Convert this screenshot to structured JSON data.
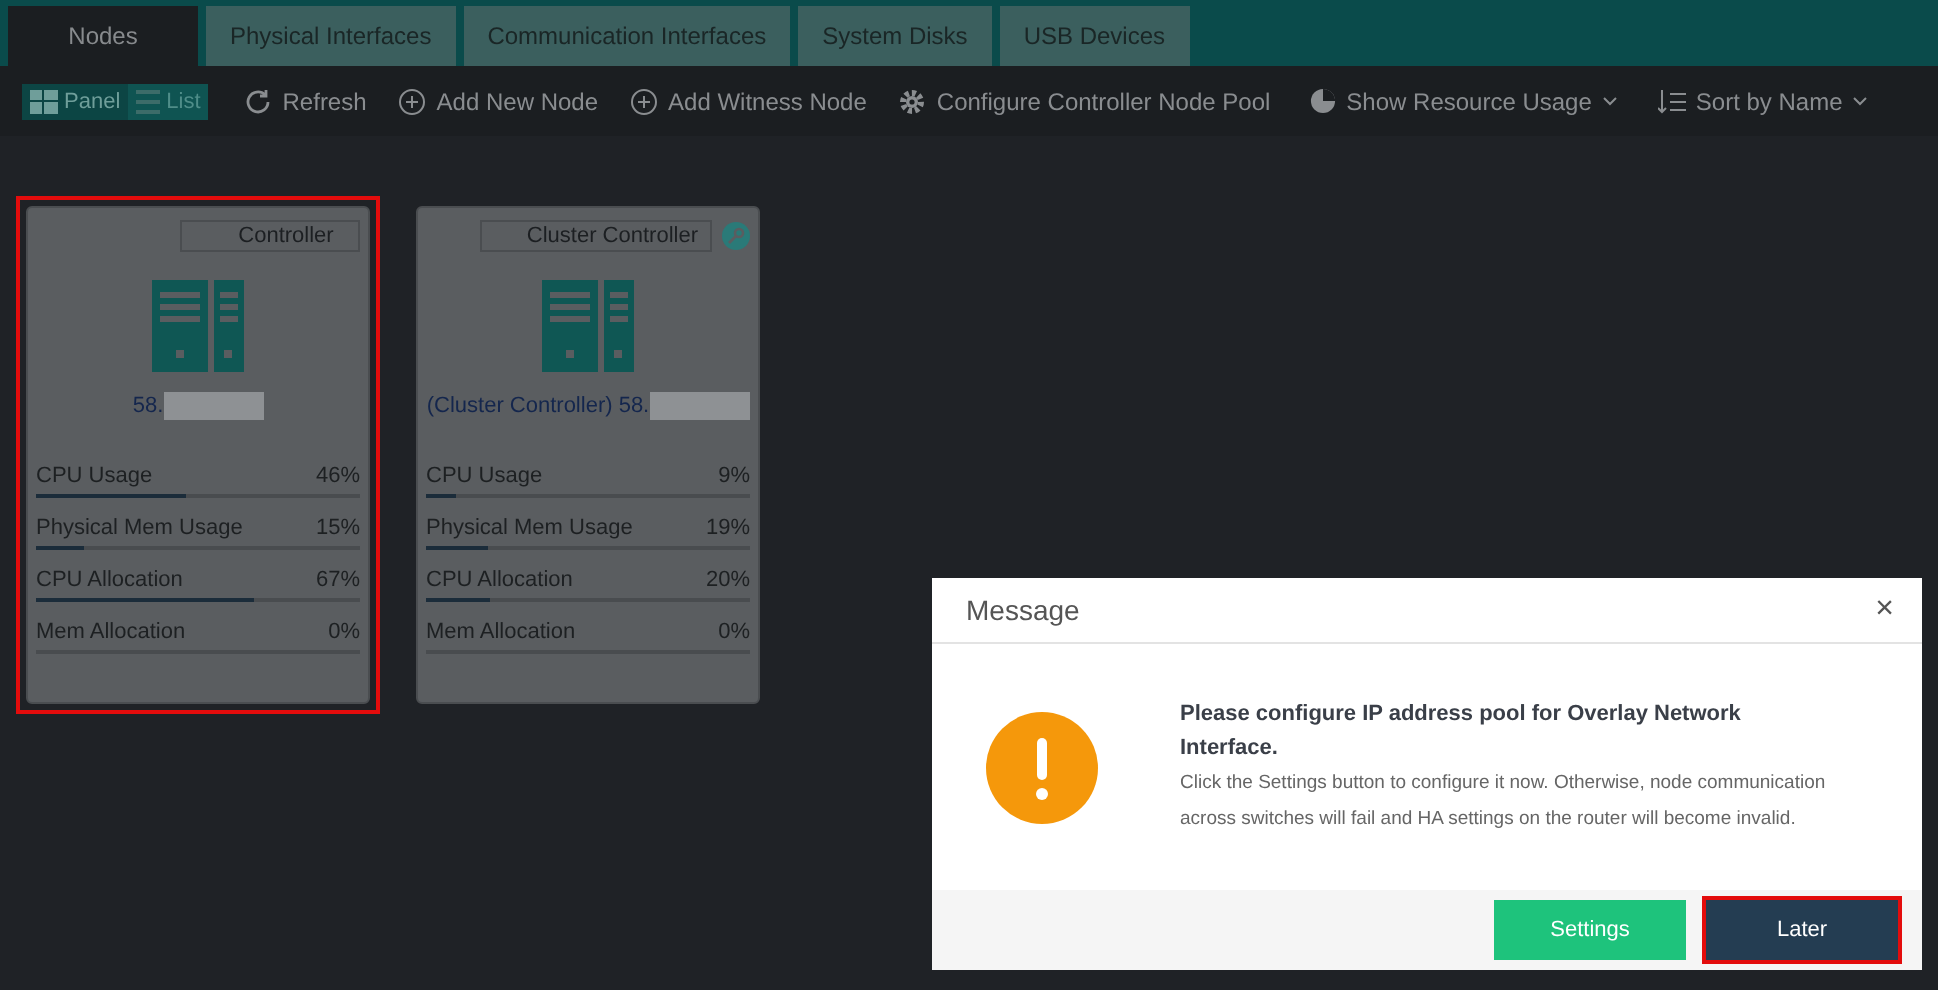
{
  "tabs": [
    {
      "label": "Nodes",
      "selected": true
    },
    {
      "label": "Physical Interfaces",
      "selected": false
    },
    {
      "label": "Communication Interfaces",
      "selected": false
    },
    {
      "label": "System Disks",
      "selected": false
    },
    {
      "label": "USB Devices",
      "selected": false
    }
  ],
  "view_toggle": [
    {
      "label": "Panel",
      "kind": "grid",
      "selected": true
    },
    {
      "label": "List",
      "kind": "list",
      "selected": false
    }
  ],
  "toolbar": [
    {
      "label": "Refresh",
      "kind": "refresh",
      "dropdown": false
    },
    {
      "label": "Add New Node",
      "kind": "add",
      "dropdown": false
    },
    {
      "label": "Add Witness Node",
      "kind": "add",
      "dropdown": false
    },
    {
      "label": "Configure Controller Node Pool",
      "kind": "gear",
      "dropdown": false
    },
    {
      "label": "Show Resource Usage",
      "kind": "pie",
      "dropdown": true
    },
    {
      "label": "Sort by Name",
      "kind": "sort",
      "dropdown": true
    }
  ],
  "nodes": [
    {
      "role": "Controller",
      "key_badge": false,
      "address": "58.",
      "highlighted": true,
      "metrics": [
        {
          "name": "CPU Usage",
          "value": "46%",
          "level": 0.46
        },
        {
          "name": "Physical Mem Usage",
          "value": "15%",
          "level": 0.15
        },
        {
          "name": "CPU Allocation",
          "value": "67%",
          "level": 0.67
        },
        {
          "name": "Mem Allocation",
          "value": "0%",
          "level": 0
        }
      ]
    },
    {
      "role": "Cluster Controller",
      "key_badge": true,
      "address": "(Cluster Controller) 58.",
      "highlighted": false,
      "metrics": [
        {
          "name": "CPU Usage",
          "value": "9%",
          "level": 0.09
        },
        {
          "name": "Physical Mem Usage",
          "value": "19%",
          "level": 0.19
        },
        {
          "name": "CPU Allocation",
          "value": "20%",
          "level": 0.2
        },
        {
          "name": "Mem Allocation",
          "value": "0%",
          "level": 0
        }
      ]
    }
  ],
  "dialog": {
    "title": "Message",
    "close": "×",
    "heading": "Please configure IP address pool for Overlay Network Interface.",
    "body": "Click the Settings button to configure it now. Otherwise, node communication across switches will fail and HA settings on the router will become invalid.",
    "buttons": [
      {
        "label": "Settings",
        "kind": "primary",
        "highlighted": false
      },
      {
        "label": "Later",
        "kind": "secondary",
        "highlighted": true
      }
    ]
  }
}
